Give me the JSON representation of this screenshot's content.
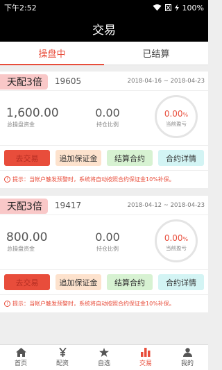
{
  "status": {
    "time": "下午2:52",
    "battery": "100%"
  },
  "header": {
    "title": "交易"
  },
  "tabs": [
    {
      "label": "操盘中",
      "active": true
    },
    {
      "label": "已结算",
      "active": false
    }
  ],
  "cards": [
    {
      "badge": "天配3倍",
      "code": "19605",
      "date_range": "2018-04-16 ~ 2018-04-23",
      "amount": "1,600.00",
      "amount_label": "总操盘资金",
      "ratio": "0.00",
      "ratio_label": "持仓比例",
      "profit_value": "0.00",
      "profit_unit": "%",
      "profit_label": "当前盈亏",
      "buttons": {
        "trade": "去交易",
        "margin": "追加保证金",
        "settle": "结算合约",
        "detail": "合约详情"
      },
      "tip": "提示：当帐户触发预警时，系统将自动按照合约保证金10%补保。"
    },
    {
      "badge": "天配3倍",
      "code": "19417",
      "date_range": "2018-04-12 ~ 2018-04-23",
      "amount": "800.00",
      "amount_label": "总操盘资金",
      "ratio": "0.00",
      "ratio_label": "持仓比例",
      "profit_value": "0.00",
      "profit_unit": "%",
      "profit_label": "当前盈亏",
      "buttons": {
        "trade": "去交易",
        "margin": "追加保证金",
        "settle": "结算合约",
        "detail": "合约详情"
      },
      "tip": "提示：当帐户触发预警时，系统将自动按照合约保证金10%补保。"
    }
  ],
  "nav": [
    {
      "label": "首页",
      "icon": "home-icon"
    },
    {
      "label": "配资",
      "icon": "yen-icon"
    },
    {
      "label": "自选",
      "icon": "star-icon"
    },
    {
      "label": "交易",
      "icon": "bar-chart-icon",
      "active": true
    },
    {
      "label": "我的",
      "icon": "user-icon"
    }
  ],
  "colors": {
    "accent": "#e84d3b",
    "header_bg": "#000000"
  }
}
